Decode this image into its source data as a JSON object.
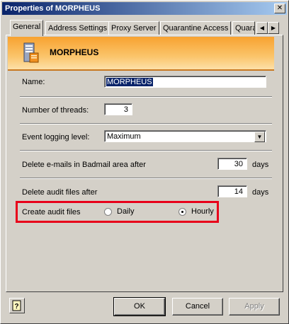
{
  "window": {
    "title": "Properties of MORPHEUS",
    "close_glyph": "✕"
  },
  "tabs": [
    {
      "label": "General",
      "active": true
    },
    {
      "label": "Address Settings"
    },
    {
      "label": "Proxy Server"
    },
    {
      "label": "Quarantine Access"
    },
    {
      "label": "Quara"
    }
  ],
  "tab_scroll": {
    "left_glyph": "◀",
    "right_glyph": "▶"
  },
  "header": {
    "server_name": "MORPHEUS",
    "icon": "server-icon",
    "accent": "#f8a230"
  },
  "form": {
    "name_label": "Name:",
    "name_value": "MORPHEUS",
    "threads_label": "Number of threads:",
    "threads_value": "3",
    "logging_label": "Event logging level:",
    "logging_value": "Maximum",
    "badmail_label": "Delete e-mails in Badmail area after",
    "badmail_value": "30",
    "badmail_unit": "days",
    "audit_delete_label": "Delete audit files after",
    "audit_delete_value": "14",
    "audit_delete_unit": "days",
    "create_audit_label": "Create audit files",
    "daily_label": "Daily",
    "hourly_label": "Hourly",
    "selected_frequency": "Hourly"
  },
  "buttons": {
    "ok": "OK",
    "cancel": "Cancel",
    "apply": "Apply",
    "help": "help-icon"
  },
  "colors": {
    "highlight": "#e8001a",
    "selection": "#0a246a",
    "title_bar": "#0a246a"
  }
}
